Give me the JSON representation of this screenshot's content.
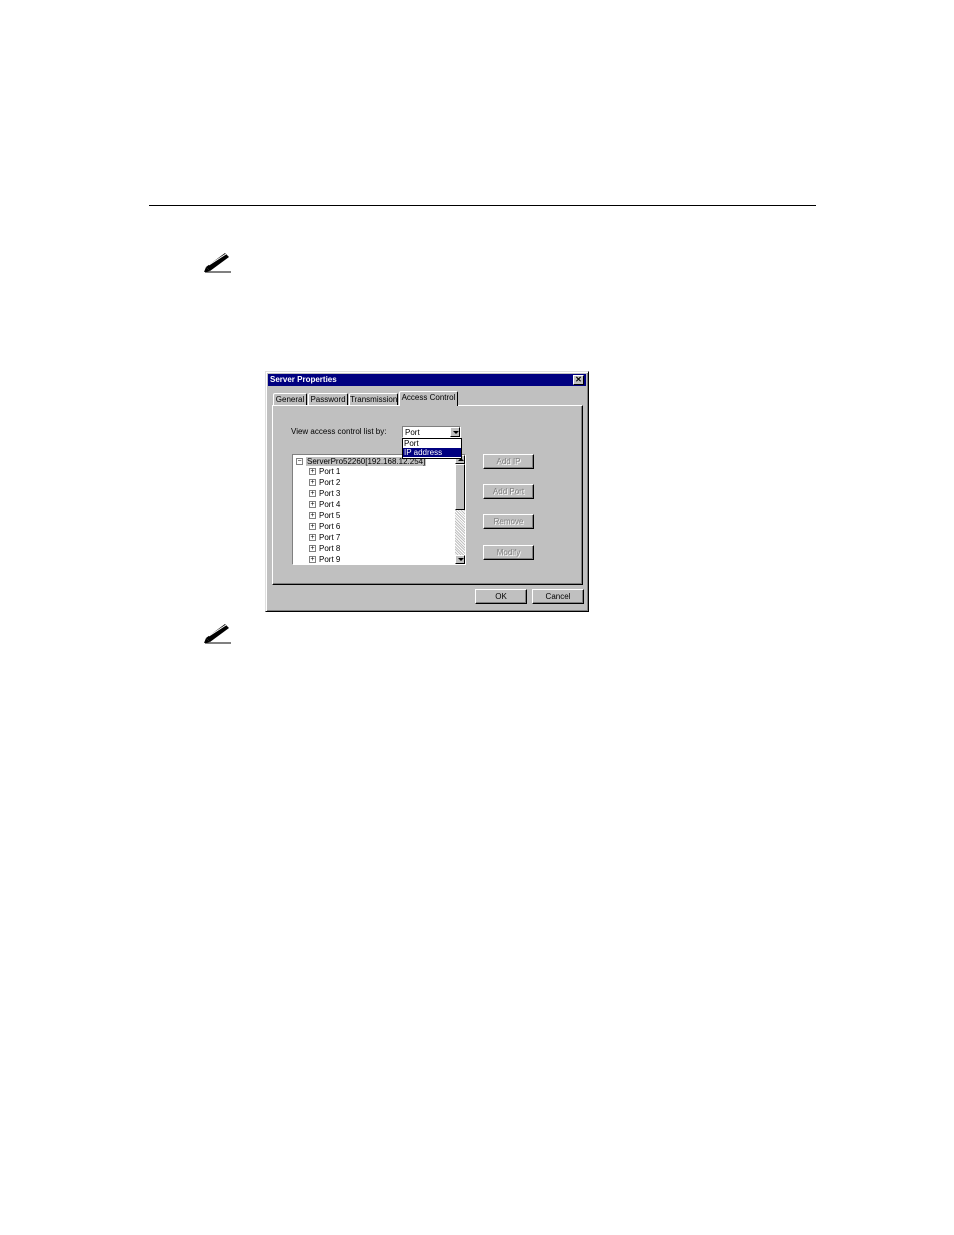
{
  "dialog": {
    "title": "Server Properties",
    "close_glyph": "✕",
    "tabs": [
      {
        "label": "General",
        "active": false
      },
      {
        "label": "Password",
        "active": false
      },
      {
        "label": "Transmission",
        "active": false
      },
      {
        "label": "Access Control",
        "active": true
      }
    ],
    "view_by": {
      "label": "View access control list by:",
      "value": "Port",
      "options": [
        "Port",
        "IP address"
      ],
      "highlighted_option": "IP address"
    },
    "tree": {
      "root_label": "ServerPro52260[192.168.12.254]",
      "root_expander": "−",
      "child_expander": "+",
      "children": [
        "Port 1",
        "Port 2",
        "Port 3",
        "Port 4",
        "Port 5",
        "Port 6",
        "Port 7",
        "Port 8",
        "Port 9"
      ]
    },
    "side_buttons": {
      "add_ip": "Add IP",
      "add_port": "Add Port",
      "remove": "Remove",
      "modify": "Modify"
    },
    "ok_label": "OK",
    "cancel_label": "Cancel"
  },
  "icons": {
    "note_icon": "pencil-note-icon"
  }
}
